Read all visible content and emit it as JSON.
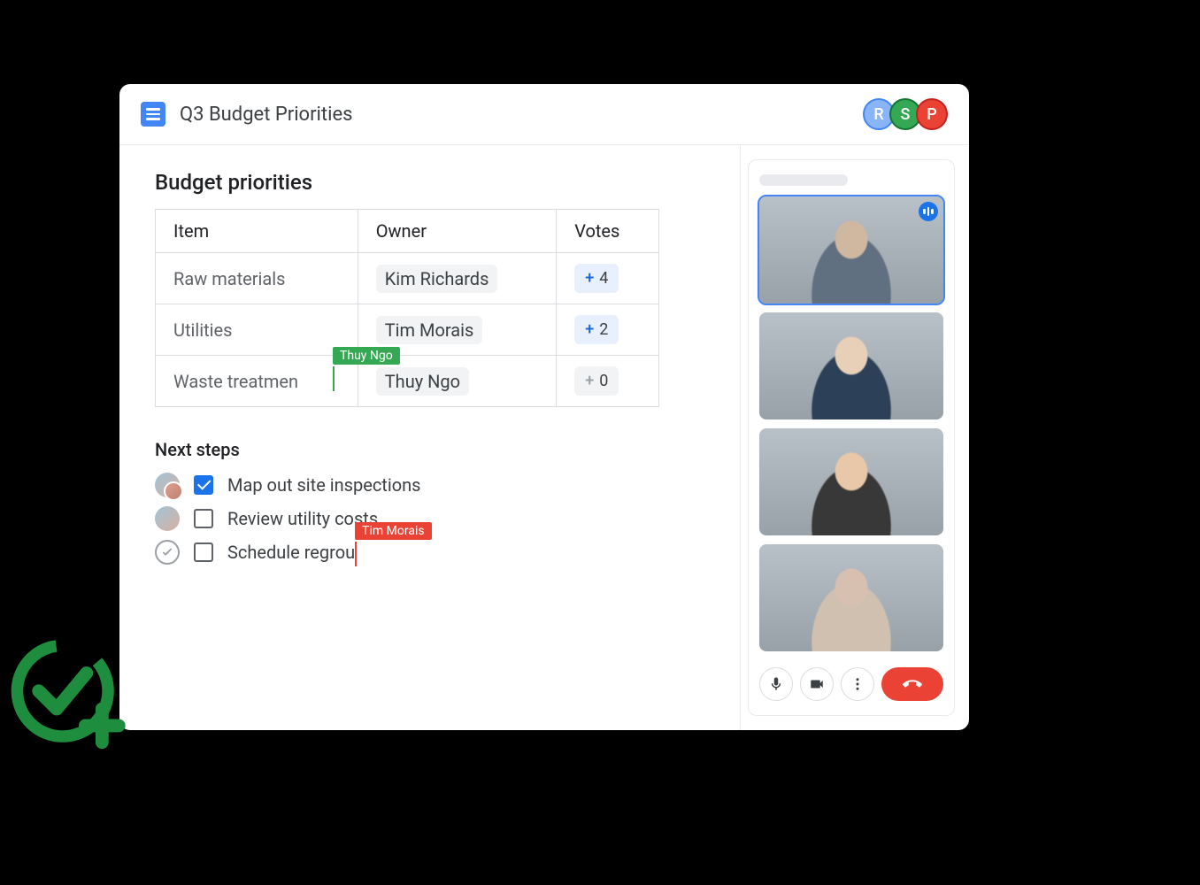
{
  "doc": {
    "title": "Q3 Budget Priorities",
    "collaborators": [
      {
        "initial": "R",
        "color": "r"
      },
      {
        "initial": "S",
        "color": "s"
      },
      {
        "initial": "P",
        "color": "p"
      }
    ]
  },
  "section1": {
    "title": "Budget priorities",
    "headers": {
      "item": "Item",
      "owner": "Owner",
      "votes": "Votes"
    },
    "rows": [
      {
        "item": "Raw materials",
        "owner": "Kim Richards",
        "votes": "4",
        "zero": false
      },
      {
        "item": "Utilities",
        "owner": "Tim Morais",
        "votes": "2",
        "zero": false
      },
      {
        "item": "Waste treatmen",
        "owner": "Thuy Ngo",
        "votes": "0",
        "zero": true
      }
    ]
  },
  "cursors": {
    "green": {
      "name": "Thuy Ngo"
    },
    "red": {
      "name": "Tim Morais"
    }
  },
  "section2": {
    "title": "Next steps",
    "tasks": [
      {
        "text": "Map out site inspections",
        "checked": true
      },
      {
        "text": "Review utility costs",
        "checked": false
      },
      {
        "text": "Schedule regrou",
        "checked": false
      }
    ]
  },
  "meet": {
    "participants": 4,
    "active_index": 0
  }
}
